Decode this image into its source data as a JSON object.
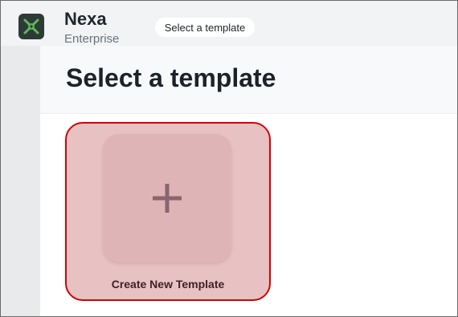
{
  "app": {
    "name": "Nexa",
    "edition": "Enterprise",
    "logo_icon": "nexa-logo-icon"
  },
  "breadcrumb": {
    "current": "Select a template"
  },
  "page": {
    "title": "Select a template"
  },
  "templates": [
    {
      "label": "Create New Template",
      "icon": "plus-icon",
      "selected": true
    }
  ],
  "colors": {
    "card_highlight": "#e8c1c3",
    "card_border": "#d40000",
    "logo_bg": "#2d3a36",
    "logo_accent": "#5cb85c"
  }
}
